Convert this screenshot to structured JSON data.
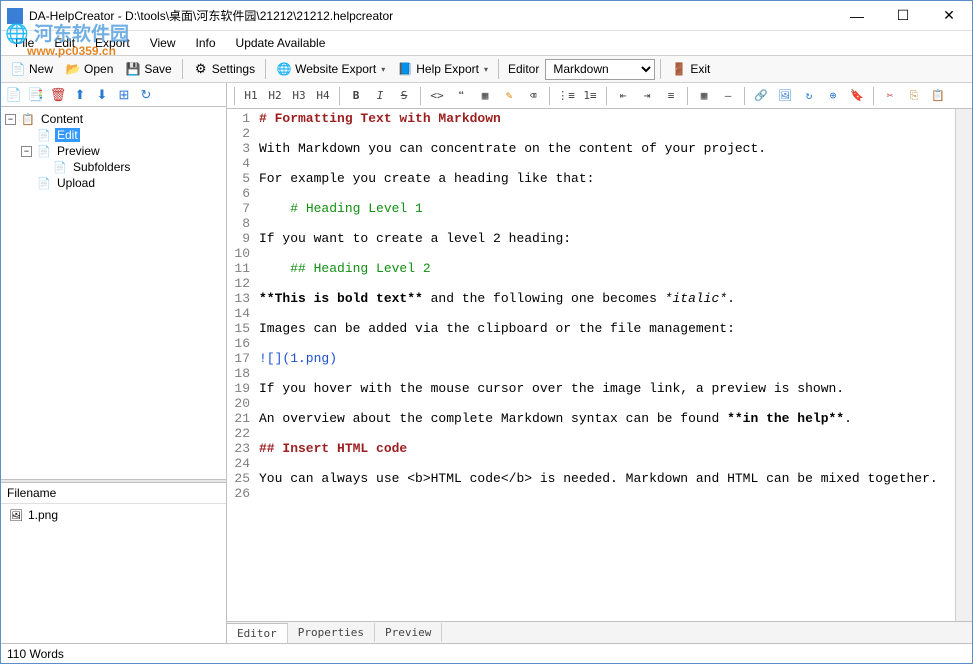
{
  "titlebar": {
    "app": "DA-HelpCreator",
    "path": "D:\\tools\\桌面\\河东软件园\\21212\\21212.helpcreator"
  },
  "menubar": {
    "items": [
      "File",
      "Edit",
      "Export",
      "View",
      "Info",
      "Update Available"
    ]
  },
  "toolbar1": {
    "new": "New",
    "open": "Open",
    "save": "Save",
    "settings": "Settings",
    "website_export": "Website Export",
    "help_export": "Help Export",
    "editor_label": "Editor",
    "editor_combo": "Markdown",
    "exit": "Exit"
  },
  "tree": {
    "root": "Content",
    "edit": "Edit",
    "preview": "Preview",
    "subfolders": "Subfolders",
    "upload": "Upload"
  },
  "filepanel": {
    "header": "Filename",
    "items": [
      "1.png"
    ]
  },
  "editor_toolbar": {
    "h": [
      "H1",
      "H2",
      "H3",
      "H4"
    ]
  },
  "code": [
    {
      "n": 1,
      "html": "<span class='m-head'># Formatting Text with Markdown</span>"
    },
    {
      "n": 2,
      "html": ""
    },
    {
      "n": 3,
      "html": "With Markdown you can concentrate on the content of your project."
    },
    {
      "n": 4,
      "html": ""
    },
    {
      "n": 5,
      "html": "For example you create a heading like that:"
    },
    {
      "n": 6,
      "html": ""
    },
    {
      "n": 7,
      "html": "    <span class='m-green'># Heading Level 1</span>"
    },
    {
      "n": 8,
      "html": ""
    },
    {
      "n": 9,
      "html": "If you want to create a level 2 heading:"
    },
    {
      "n": 10,
      "html": ""
    },
    {
      "n": 11,
      "html": "    <span class='m-green'>## Heading Level 2</span>"
    },
    {
      "n": 12,
      "html": ""
    },
    {
      "n": 13,
      "html": "<span class='m-bold'>**This is bold text**</span> and the following one becomes <span class='m-ital'>*italic*</span>."
    },
    {
      "n": 14,
      "html": ""
    },
    {
      "n": 15,
      "html": "Images can be added via the clipboard or the file management:"
    },
    {
      "n": 16,
      "html": ""
    },
    {
      "n": 17,
      "html": "<span class='m-link'>![](1.png)</span>"
    },
    {
      "n": 18,
      "html": ""
    },
    {
      "n": 19,
      "html": "If you hover with the mouse cursor over the image link, a preview is shown."
    },
    {
      "n": 20,
      "html": ""
    },
    {
      "n": 21,
      "html": "An overview about the complete Markdown syntax can be found <span class='m-bold'>**in the help**</span>."
    },
    {
      "n": 22,
      "html": ""
    },
    {
      "n": 23,
      "html": "<span class='m-head2'>## Insert HTML code</span>"
    },
    {
      "n": 24,
      "html": ""
    },
    {
      "n": 25,
      "html": "You can always use &lt;b&gt;HTML code&lt;/b&gt; is needed. Markdown and HTML can be mixed together."
    },
    {
      "n": 26,
      "html": ""
    }
  ],
  "editor_tabs": {
    "editor": "Editor",
    "properties": "Properties",
    "preview": "Preview"
  },
  "status": {
    "words": "110 Words"
  },
  "watermark": {
    "text": "河东软件园",
    "url": "www.pc0359.cn"
  }
}
